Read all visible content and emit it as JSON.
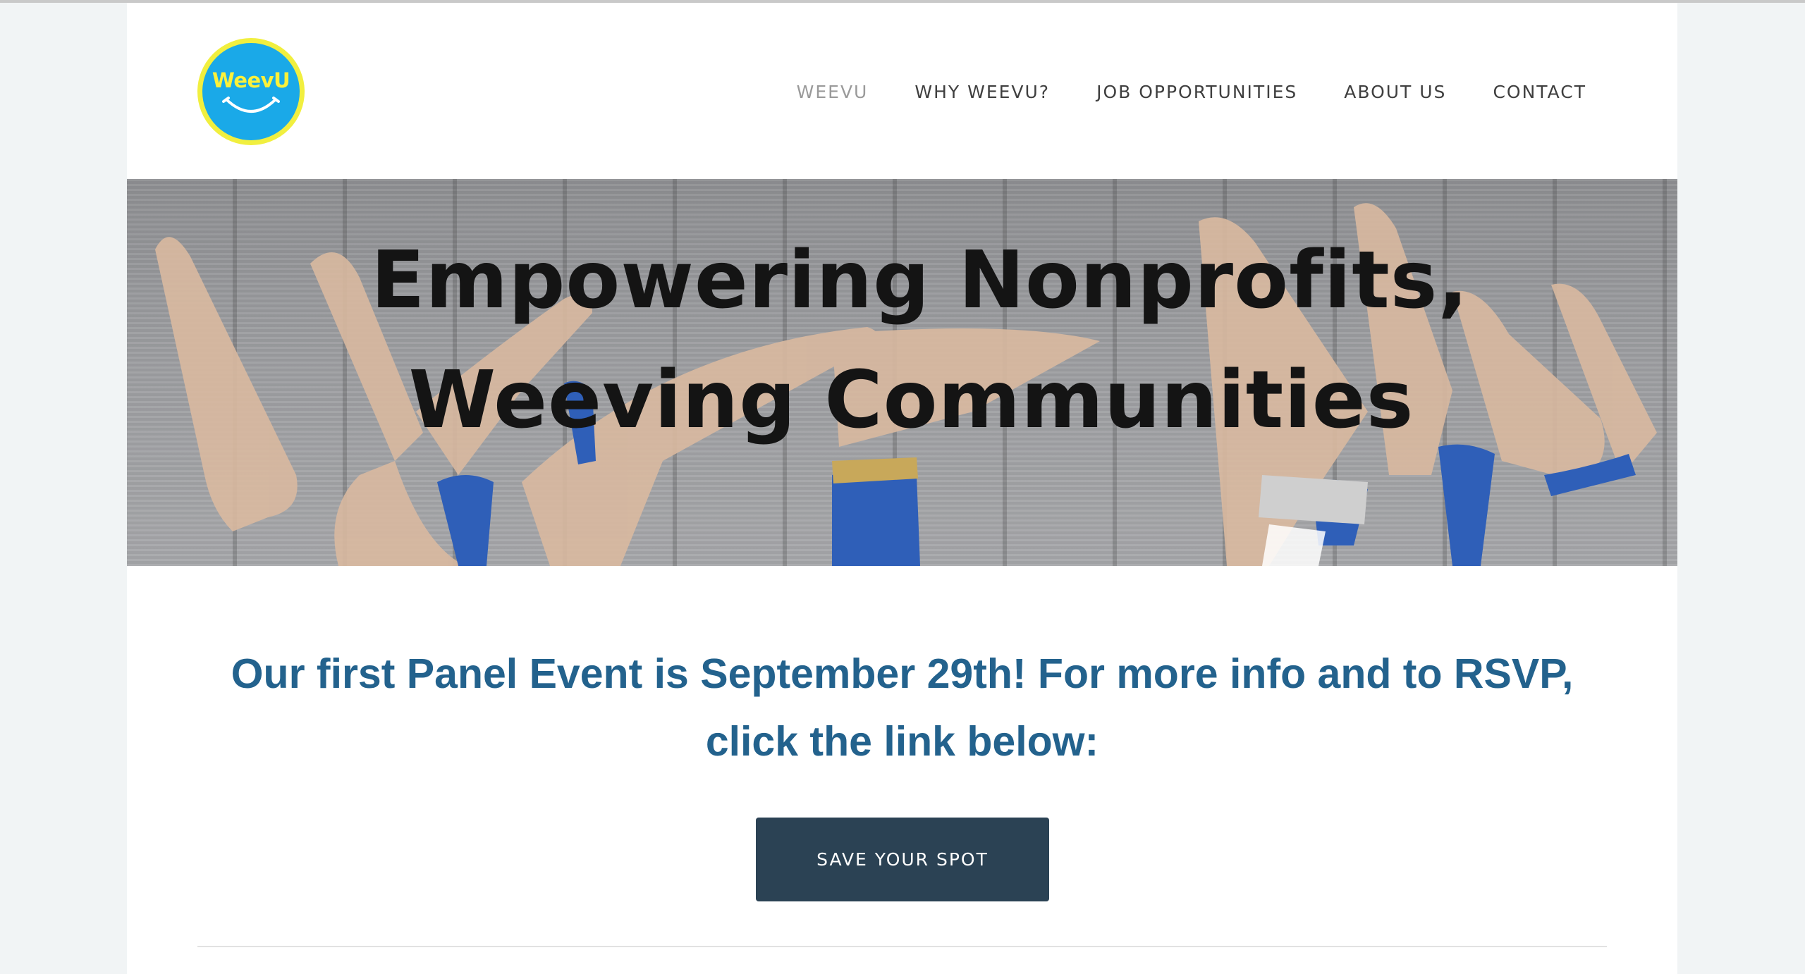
{
  "header": {
    "logo_text": "WeevU",
    "nav": [
      {
        "label": "WEEVU",
        "active": true
      },
      {
        "label": "WHY WEEVU?",
        "active": false
      },
      {
        "label": "JOB OPPORTUNITIES",
        "active": false
      },
      {
        "label": "ABOUT US",
        "active": false
      },
      {
        "label": "CONTACT",
        "active": false
      }
    ]
  },
  "banner": {
    "line1": "Empowering Nonprofits,",
    "line2": "Weeving Communities"
  },
  "main": {
    "announcement": "Our first Panel Event is September 29th! For more info and to RSVP, click the link below:",
    "cta_label": "SAVE YOUR SPOT"
  },
  "colors": {
    "logo_bg": "#1aa9e8",
    "logo_ring": "#f1ef3f",
    "heading": "#23628d",
    "button": "#2b4254"
  },
  "icons": {
    "logo": "smile-logo-icon"
  }
}
